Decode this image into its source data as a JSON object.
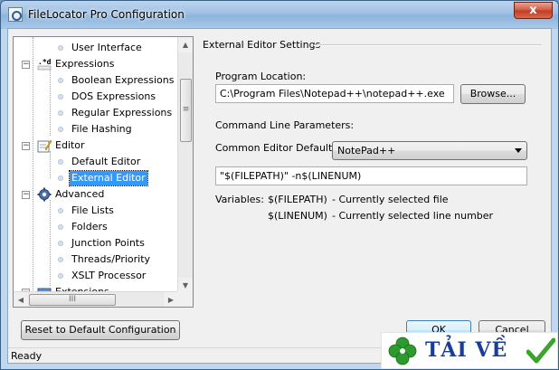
{
  "window": {
    "title": "FileLocator Pro Configuration",
    "close_glyph": "x"
  },
  "tree": {
    "items": [
      {
        "label": "User Interface",
        "level": 2
      },
      {
        "label": "Expressions",
        "level": 1,
        "icon": "regex-icon"
      },
      {
        "label": "Boolean Expressions",
        "level": 2
      },
      {
        "label": "DOS Expressions",
        "level": 2
      },
      {
        "label": "Regular Expressions",
        "level": 2
      },
      {
        "label": "File Hashing",
        "level": 2
      },
      {
        "label": "Editor",
        "level": 1,
        "icon": "editor-icon"
      },
      {
        "label": "Default Editor",
        "level": 2
      },
      {
        "label": "External Editor",
        "level": 2,
        "selected": true
      },
      {
        "label": "Advanced",
        "level": 1,
        "icon": "gear-icon"
      },
      {
        "label": "File Lists",
        "level": 2
      },
      {
        "label": "Folders",
        "level": 2
      },
      {
        "label": "Junction Points",
        "level": 2
      },
      {
        "label": "Threads/Priority",
        "level": 2
      },
      {
        "label": "XSLT Processor",
        "level": 2
      },
      {
        "label": "Extensions",
        "level": 1,
        "icon": "extensions-icon"
      }
    ],
    "expander_glyph": "−",
    "scroll_thumb_grip": "≡",
    "hscroll_thumb_grip": "III",
    "arrow_up": "▲",
    "arrow_down": "▼",
    "arrow_left": "◀",
    "arrow_right": "▶"
  },
  "panel": {
    "section_title": "External Editor Settings",
    "program_location_label": "Program Location:",
    "program_location_value": "C:\\Program Files\\Notepad++\\notepad++.exe",
    "browse_label": "Browse...",
    "cmdline_label": "Command Line Parameters:",
    "defaults_label": "Common Editor Defaults:",
    "defaults_selected": "NotePad++",
    "params_value": "\"$(FILEPATH)\" -n$(LINENUM)",
    "variables_label": "Variables:",
    "variables": [
      {
        "name": "$(FILEPATH)",
        "desc": "- Currently selected file"
      },
      {
        "name": "$(LINENUM)",
        "desc": "- Currently selected line number"
      }
    ]
  },
  "buttons": {
    "reset": "Reset to Default Configuration",
    "ok": "OK",
    "cancel": "Cancel"
  },
  "status": {
    "text": "Ready"
  },
  "watermark": {
    "text": "TẢI VỀ",
    "leaf_icon": "clover-icon",
    "check_icon": "checkmark-icon"
  }
}
